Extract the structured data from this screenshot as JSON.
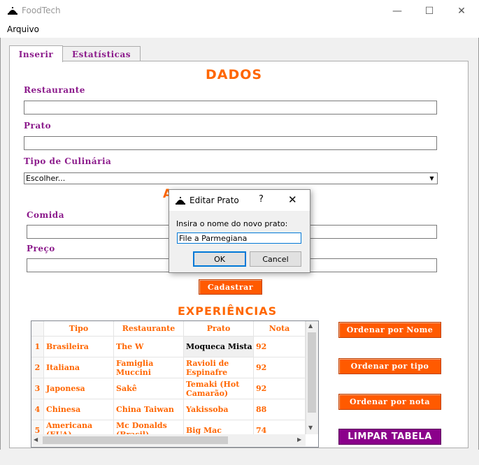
{
  "window": {
    "title": "FoodTech",
    "controls": {
      "minimize": "—",
      "maximize": "☐",
      "close": "✕"
    }
  },
  "menu": {
    "arquivo": "Arquivo"
  },
  "tabs": [
    {
      "label": "Inserir",
      "active": true
    },
    {
      "label": "Estatísticas",
      "active": false
    }
  ],
  "form": {
    "dados_title": "DADOS",
    "restaurante_label": "Restaurante",
    "restaurante_value": "",
    "prato_label": "Prato",
    "prato_value": "",
    "tipo_label": "Tipo de Culinária",
    "tipo_selected": "Escolher...",
    "avaliacao_title_partial": "A",
    "comida_label": "Comida",
    "comida_value": "",
    "preco_label": "Preço",
    "preco_value": "",
    "cadastrar_button": "Cadastrar"
  },
  "experiencias": {
    "title": "EXPERIÊNCIAS",
    "columns": [
      "Tipo",
      "Restaurante",
      "Prato",
      "Nota"
    ],
    "rows": [
      {
        "n": "1",
        "tipo": "Brasileira",
        "restaurante": "The W",
        "prato": "Moqueca Mista",
        "nota": "92"
      },
      {
        "n": "2",
        "tipo": "Italiana",
        "restaurante": "Famiglia Muccini",
        "prato": "Ravioli de Espinafre",
        "nota": "92"
      },
      {
        "n": "3",
        "tipo": "Japonesa",
        "restaurante": "Sakê",
        "prato": "Temaki (Hot Camarão)",
        "nota": "92"
      },
      {
        "n": "4",
        "tipo": "Chinesa",
        "restaurante": "China Taiwan",
        "prato": "Yakissoba",
        "nota": "88"
      },
      {
        "n": "5",
        "tipo": "Americana (EUA)",
        "restaurante": "Mc Donalds (Brasil)",
        "prato": "Big Mac",
        "nota": "74"
      }
    ],
    "selected_cell": "row1-prato"
  },
  "side_buttons": {
    "ordenar_nome": "Ordenar por Nome",
    "ordenar_tipo": "Ordenar por tipo",
    "ordenar_nota": "Ordenar por nota",
    "limpar": "LIMPAR TABELA"
  },
  "dialog": {
    "title": "Editar Prato",
    "help": "?",
    "close": "✕",
    "prompt": "Insira o nome do novo prato:",
    "input_value": "File a Parmegiana",
    "ok": "OK",
    "cancel": "Cancel"
  },
  "colors": {
    "orange": "#ff6600",
    "purple": "#8b1a8b",
    "button_orange": "#ff5a00",
    "button_purple": "#8b008b"
  },
  "icons": {
    "app": "food-dome-icon",
    "dialog": "food-dome-icon",
    "combo_arrow": "chevron-down-icon"
  }
}
